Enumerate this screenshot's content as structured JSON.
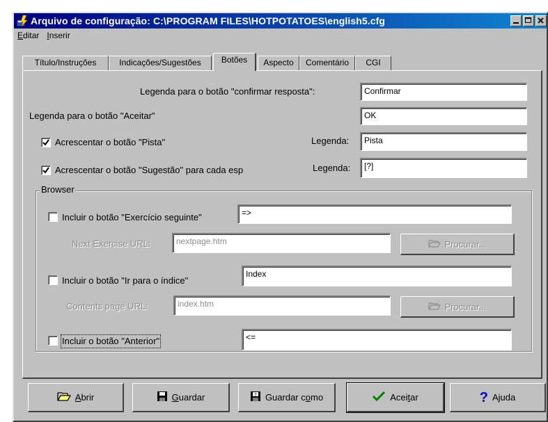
{
  "window": {
    "title": "Arquivo de configuração: C:\\PROGRAM FILES\\HOTPOTATOES\\english5.cfg"
  },
  "menu": {
    "editar": "E",
    "editar_rest": "ditar",
    "inserir": "I",
    "inserir_rest": "nserir"
  },
  "tabs": [
    {
      "label": "Título/Instruções"
    },
    {
      "label": "Indicações/Sugestões"
    },
    {
      "label": "Botões",
      "active": true
    },
    {
      "label": "Aspecto"
    },
    {
      "label": "Comentário"
    },
    {
      "label": "CGI"
    }
  ],
  "form": {
    "confirm_label": "Legenda para o botão \"confirmar resposta\":",
    "confirm_value": "Confirmar",
    "accept_label": "Legenda para o botão \"Aceitar\"",
    "accept_value": "OK",
    "hint_check_label": "Acrescentar o botão \"Pista\"",
    "hint_checked": true,
    "hint_caption_label": "Legenda:",
    "hint_value": "Pista",
    "suggest_check_label": "Acrescentar o botão \"Sugestão\" para cada esp",
    "suggest_checked": true,
    "suggest_caption_label": "Legenda:",
    "suggest_value": "[?]"
  },
  "browser": {
    "group_label": "Browser",
    "next_check_label": "Incluir o botão \"Exercício seguinte\"",
    "next_checked": false,
    "next_value": "=>",
    "next_url_label": "Next Exercise URL:",
    "next_url_value": "nextpage.htm",
    "browse1": "Procurar...",
    "index_check_label": "Incluir o botão  \"Ir para o índice\"",
    "index_checked": false,
    "index_value": "Index",
    "contents_url_label": "Contents page URL:",
    "contents_url_value": "index.htm",
    "browse2": "Procurar...",
    "prev_check_label": "Incluir o botão \"Anterior\"",
    "prev_checked": false,
    "prev_value": "<="
  },
  "buttons": {
    "open_u": "A",
    "open_rest": "brir",
    "save_u": "G",
    "save_rest": "uardar",
    "saveas_pre": "Guardar c",
    "saveas_u": "o",
    "saveas_rest": "mo",
    "ok_pre": "Acei",
    "ok_u": "t",
    "ok_rest": "ar",
    "help_pre": "A",
    "help_u": "j",
    "help_rest": "uda"
  },
  "colors": {
    "title_start": "#000080",
    "title_end": "#1084d0",
    "face": "#c0c0c0",
    "disabled_text": "#8c8c8c",
    "check_green": "#008000",
    "help_blue": "#0000c0"
  }
}
